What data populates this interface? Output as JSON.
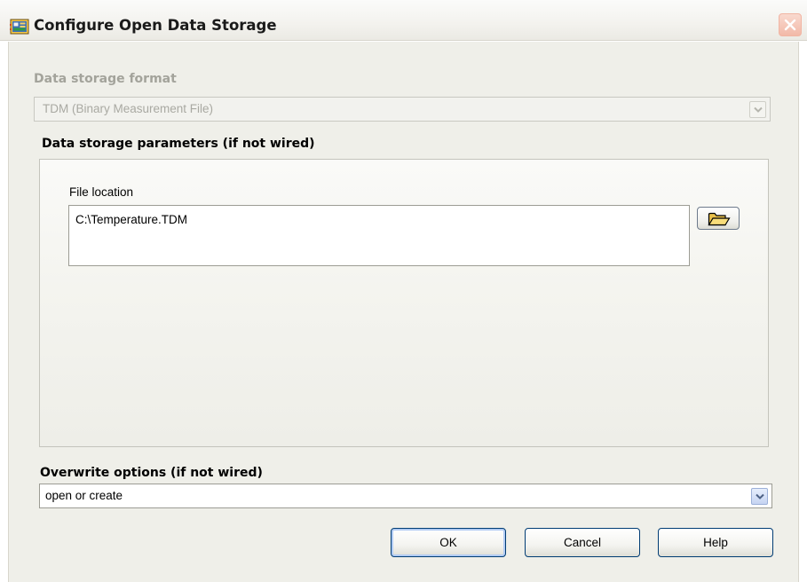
{
  "window": {
    "title": "Configure Open Data Storage",
    "app_icon": "labview-express-vi-icon",
    "close_icon": "close-icon"
  },
  "format": {
    "label": "Data storage format",
    "selected": "TDM (Binary Measurement File)",
    "enabled": false
  },
  "parameters": {
    "label": "Data storage parameters (if not wired)",
    "file_location_label": "File location",
    "file_location_value": "C:\\Temperature.TDM",
    "browse_icon": "folder-open-icon"
  },
  "overwrite": {
    "label": "Overwrite options (if not wired)",
    "selected": "open or create"
  },
  "buttons": {
    "ok": "OK",
    "cancel": "Cancel",
    "help": "Help"
  },
  "colors": {
    "dialog_background": "#efefe9",
    "button_border": "#003c74",
    "disabled_text": "#a3a39b"
  }
}
